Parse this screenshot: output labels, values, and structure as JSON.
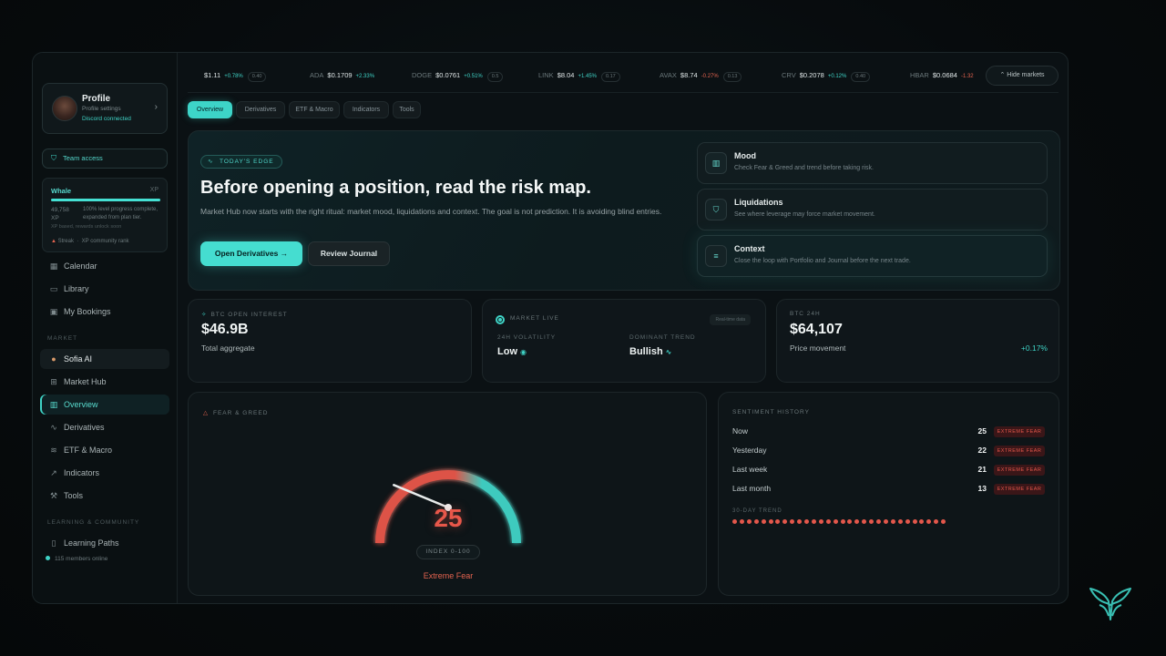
{
  "profile": {
    "name": "Profile",
    "subtitle": "Profile settings",
    "status": "Discord connected"
  },
  "sidebar": {
    "team_access": "Team access",
    "xp": {
      "tier": "Whale",
      "label": "XP",
      "progress": 1.0,
      "value": "49,758 XP",
      "desc": "100% level progress complete, expanded from plan tier.",
      "note": "XP based, rewards unlock soon",
      "foot_a": "Streak",
      "foot_b": "XP community rank"
    },
    "items_top": [
      {
        "label": "Calendar",
        "icon": "calendar-icon"
      },
      {
        "label": "Library",
        "icon": "folder-icon"
      },
      {
        "label": "My Bookings",
        "icon": "bookings-icon"
      }
    ],
    "market_label": "MARKET",
    "items_market": [
      {
        "label": "Sofia AI",
        "icon": "ai-avatar-icon"
      },
      {
        "label": "Market Hub",
        "icon": "grid-icon"
      },
      {
        "label": "Overview",
        "icon": "chart-icon"
      },
      {
        "label": "Derivatives",
        "icon": "pulse-icon"
      },
      {
        "label": "ETF & Macro",
        "icon": "layers-icon"
      },
      {
        "label": "Indicators",
        "icon": "trend-icon"
      },
      {
        "label": "Tools",
        "icon": "wrench-icon"
      }
    ],
    "learning_label": "LEARNING & COMMUNITY",
    "items_learning": [
      {
        "label": "Learning Paths",
        "icon": "book-icon"
      }
    ],
    "online": "115 members online"
  },
  "ticker": [
    {
      "sym": "",
      "price": "$1.11",
      "change": "+0.78%",
      "chip": "0.40",
      "dir": "up"
    },
    {
      "sym": "ADA",
      "price": "$0.1709",
      "change": "+2.33%",
      "chip": "",
      "dir": "up"
    },
    {
      "sym": "DOGE",
      "price": "$0.0761",
      "change": "+0.51%",
      "chip": "0.5",
      "dir": "up"
    },
    {
      "sym": "LINK",
      "price": "$8.04",
      "change": "+1.45%",
      "chip": "0.17",
      "dir": "up"
    },
    {
      "sym": "AVAX",
      "price": "$8.74",
      "change": "-0.27%",
      "chip": "0.13",
      "dir": "down"
    },
    {
      "sym": "CRV",
      "price": "$0.2078",
      "change": "+0.12%",
      "chip": "0.40",
      "dir": "up"
    },
    {
      "sym": "HBAR",
      "price": "$0.0684",
      "change": "-1.32",
      "chip": "",
      "dir": "down"
    }
  ],
  "hide_markets": "Hide markets",
  "tabs": [
    "Overview",
    "Derivatives",
    "ETF & Macro",
    "Indicators",
    "Tools"
  ],
  "hero": {
    "badge": "TODAY'S EDGE",
    "title": "Before opening a position, read the risk map.",
    "text": "Market Hub now starts with the right ritual: market mood, liquidations and context. The goal is not prediction. It is avoiding blind entries.",
    "primary": "Open Derivatives →",
    "secondary": "Review Journal",
    "cards": [
      {
        "title": "Mood",
        "sub": "Check Fear & Greed and trend before taking risk.",
        "icon": "bar-chart-icon"
      },
      {
        "title": "Liquidations",
        "sub": "See where leverage may force market movement.",
        "icon": "shield-icon"
      },
      {
        "title": "Context",
        "sub": "Close the loop with Portfolio and Journal before the next trade.",
        "icon": "lines-icon"
      }
    ]
  },
  "stats": {
    "oi": {
      "label": "BTC OPEN INTEREST",
      "value": "$46.9B",
      "sub": "Total aggregate"
    },
    "live": {
      "label": "MARKET LIVE",
      "chip": "Real-time data",
      "vol_label": "24H VOLATILITY",
      "vol_value": "Low",
      "trend_label": "DOMINANT TREND",
      "trend_value": "Bullish"
    },
    "btc": {
      "label": "BTC 24H",
      "value": "$64,107",
      "sub": "Price movement",
      "change": "+0.17%"
    }
  },
  "fear_greed": {
    "label": "FEAR & GREED",
    "value": 25,
    "value_text": "25",
    "scale": "INDEX 0-100",
    "caption": "Extreme Fear",
    "colors": {
      "fear": "#e8574a",
      "greed": "#3fd3c6"
    }
  },
  "history": {
    "label": "SENTIMENT HISTORY",
    "rows": [
      {
        "when": "Now",
        "value": "25",
        "tag": "EXTREME FEAR"
      },
      {
        "when": "Yesterday",
        "value": "22",
        "tag": "EXTREME FEAR"
      },
      {
        "when": "Last week",
        "value": "21",
        "tag": "EXTREME FEAR"
      },
      {
        "when": "Last month",
        "value": "13",
        "tag": "EXTREME FEAR"
      }
    ],
    "trend_label": "30-DAY TREND",
    "trend_points": 30
  },
  "colors": {
    "accent": "#3fd3c6",
    "danger": "#e3574b",
    "background": "#0b1114"
  }
}
